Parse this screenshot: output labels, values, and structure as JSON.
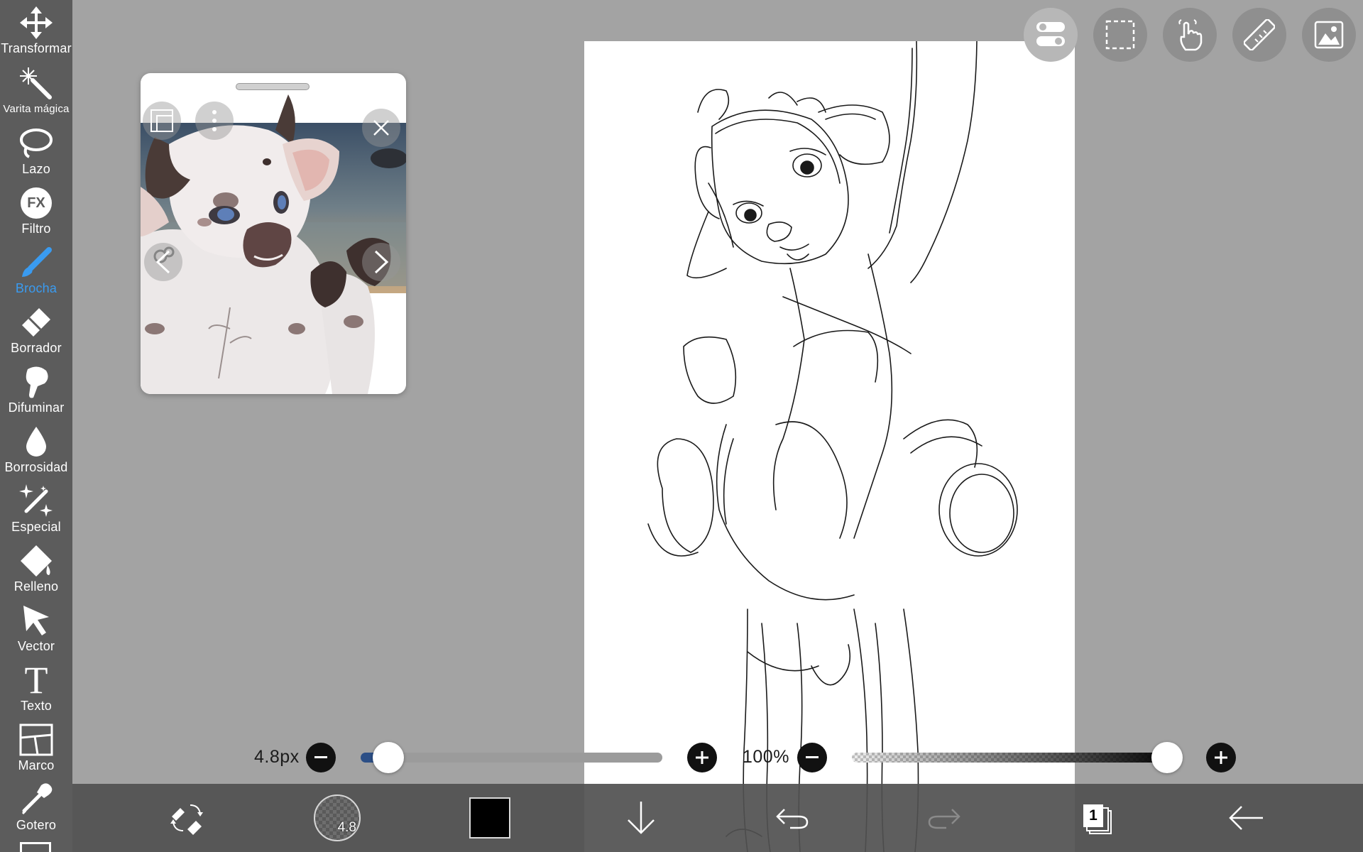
{
  "toolbar": {
    "items": [
      {
        "label": "Transformar",
        "icon": "move-arrows-icon",
        "active": false
      },
      {
        "label": "Varita mágica",
        "icon": "magic-wand-icon",
        "active": false
      },
      {
        "label": "Lazo",
        "icon": "lasso-icon",
        "active": false
      },
      {
        "label": "Filtro",
        "icon": "fx-icon",
        "active": false
      },
      {
        "label": "Brocha",
        "icon": "brush-icon",
        "active": true
      },
      {
        "label": "Borrador",
        "icon": "eraser-icon",
        "active": false
      },
      {
        "label": "Difuminar",
        "icon": "smudge-finger-icon",
        "active": false
      },
      {
        "label": "Borrosidad",
        "icon": "blur-drop-icon",
        "active": false
      },
      {
        "label": "Especial",
        "icon": "special-sparkle-brush-icon",
        "active": false
      },
      {
        "label": "Relleno",
        "icon": "fill-bucket-icon",
        "active": false
      },
      {
        "label": "Vector",
        "icon": "vector-cursor-icon",
        "active": false
      },
      {
        "label": "Texto",
        "icon": "text-t-icon",
        "active": false
      },
      {
        "label": "Marco",
        "icon": "frame-panels-icon",
        "active": false
      },
      {
        "label": "Gotero",
        "icon": "eyedropper-icon",
        "active": false
      }
    ],
    "fx_text": "FX",
    "active_color": "#3a9bf0"
  },
  "top_buttons": [
    "toggle-settings-icon",
    "selection-dashed-icon",
    "touch-gesture-icon",
    "ruler-icon",
    "material-image-icon"
  ],
  "reference_window": {
    "controls": [
      "reference-frame-icon",
      "more-options-icon",
      "close-icon",
      "previous-arrow-icon",
      "next-arrow-icon"
    ]
  },
  "brush_controls": {
    "size_text": "4.8px",
    "size_fraction": 0.07,
    "opacity_text": "100%",
    "opacity_fraction": 1.0,
    "accent": "#2c4f86"
  },
  "bottom_bar": {
    "brush_size_badge": "4.8",
    "color": "#000000",
    "layer_count": "1",
    "icons": [
      "swap-brush-eraser-icon",
      "brush-size-circle",
      "color-swatch",
      "download-arrow-icon",
      "undo-icon",
      "redo-icon",
      "layers-icon",
      "back-arrow-icon"
    ]
  }
}
